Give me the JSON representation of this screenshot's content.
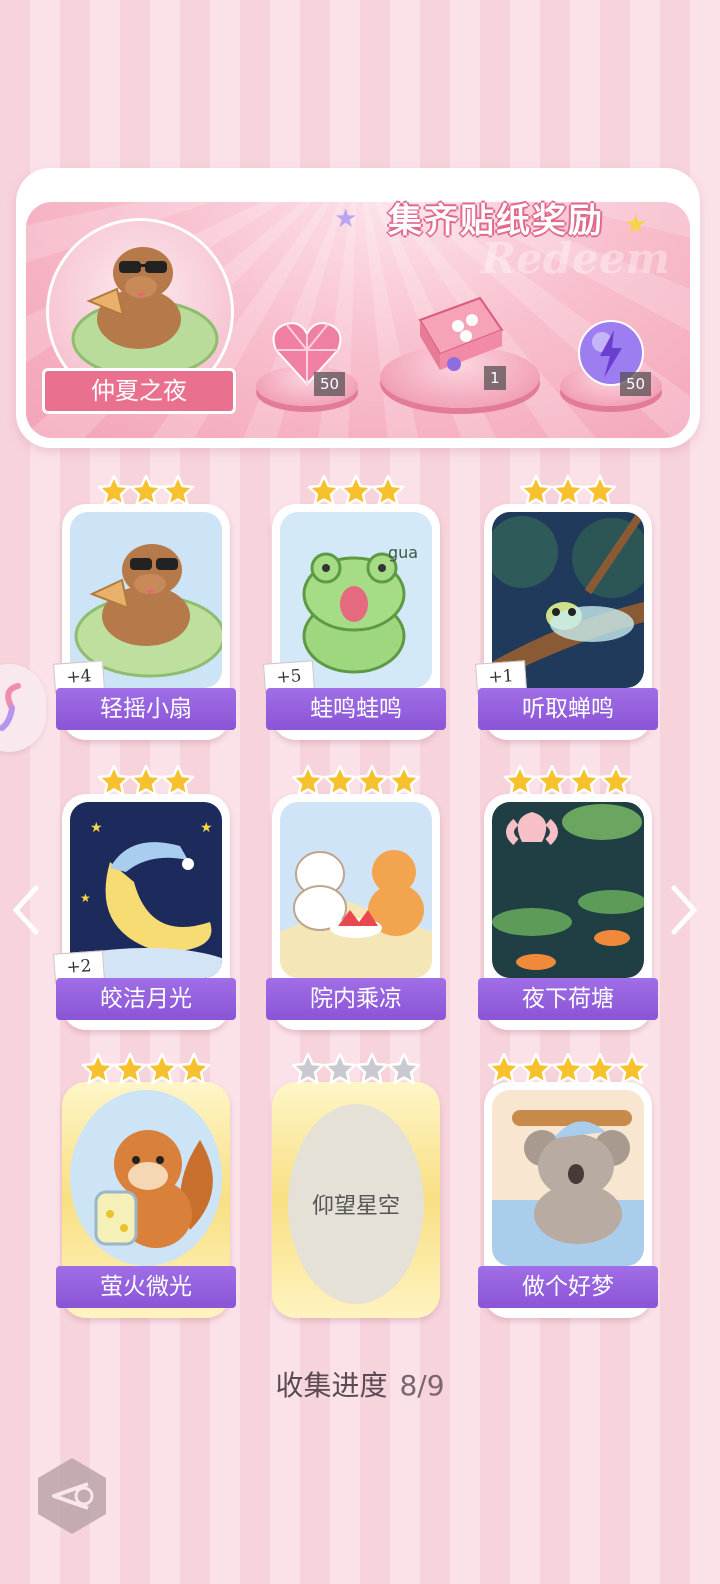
{
  "banner": {
    "title": "集齐贴纸奖励",
    "ghost": "Redeem",
    "medal_label": "仲夏之夜",
    "rewards": [
      {
        "icon": "pink-heart-gem-icon",
        "count": "50"
      },
      {
        "icon": "gift-box-icon",
        "count": "1"
      },
      {
        "icon": "purple-lightning-orb-icon",
        "count": "50"
      }
    ]
  },
  "cards": [
    {
      "name": "轻摇小扇",
      "stars": 3,
      "collected": true,
      "bonus": "+4",
      "art": "capybara-fan"
    },
    {
      "name": "蛙鸣蛙鸣",
      "stars": 3,
      "collected": true,
      "bonus": "+5",
      "art": "frog"
    },
    {
      "name": "听取蝉鸣",
      "stars": 3,
      "collected": true,
      "bonus": "+1",
      "art": "cicada"
    },
    {
      "name": "皎洁月光",
      "stars": 3,
      "collected": true,
      "bonus": "+2",
      "art": "moon"
    },
    {
      "name": "院内乘凉",
      "stars": 4,
      "collected": true,
      "bonus": "",
      "art": "cats-watermelon"
    },
    {
      "name": "夜下荷塘",
      "stars": 4,
      "collected": true,
      "bonus": "",
      "art": "lotus-pond"
    },
    {
      "name": "萤火微光",
      "stars": 4,
      "collected": true,
      "bonus": "",
      "art": "squirrel-firefly",
      "gold": true
    },
    {
      "name": "仰望星空",
      "stars": 4,
      "collected": false,
      "bonus": "",
      "art": "locked",
      "gold": true
    },
    {
      "name": "做个好梦",
      "stars": 5,
      "collected": true,
      "bonus": "",
      "art": "koala-sleep"
    }
  ],
  "progress": {
    "label": "收集进度",
    "value": "8/9"
  },
  "colors": {
    "name_bar": "#8a55d6",
    "star": "#f6c12d",
    "star_empty": "#c9c9cf",
    "banner": "#f3a3b7"
  }
}
